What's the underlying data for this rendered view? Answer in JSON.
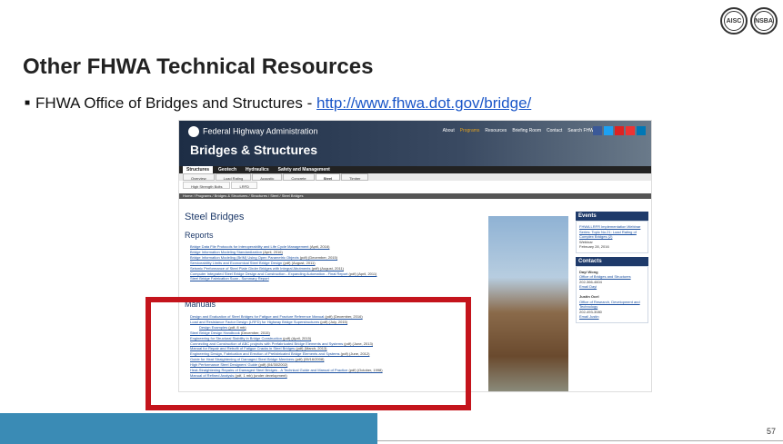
{
  "slide": {
    "title": "Other FHWA Technical Resources",
    "bullet_text": "FHWA Office of Bridges and Structures - ",
    "bullet_link": "http://www.fhwa.dot.gov/bridge/",
    "page_number": "57",
    "logos": [
      "AISC",
      "NSBA"
    ]
  },
  "website": {
    "agency": "Federal Highway Administration",
    "site_name": "Bridges & Structures",
    "top_links": [
      "About",
      "Programs",
      "Resources",
      "Briefing Room",
      "Contact",
      "Search FHWA"
    ],
    "nav_primary": [
      "Structures",
      "Geotech",
      "Hydraulics",
      "Safety and Management"
    ],
    "nav_secondary": [
      "Overview",
      "Load Rating",
      "Acoustic",
      "Concrete",
      "Steel",
      "Timber"
    ],
    "nav_tertiary": [
      "High Strength Bolts",
      "LRFD"
    ],
    "breadcrumb": "Home / Programs / Bridges & Structures / Structures / Steel / Steel Bridges",
    "page_heading": "Steel Bridges",
    "reports_heading": "Reports",
    "reports": [
      {
        "text": "Bridge Data File Protocols for Interoperability and Life Cycle Management",
        "note": " (April, 2016)"
      },
      {
        "text": "Bridge Information Modeling Standardization",
        "note": " (April, 2016)"
      },
      {
        "text": "Bridge Information Modeling (BrIM) Using Open Parametric Objects",
        "note": " (pdf) (December, 2015)"
      },
      {
        "text": "Serviceability Limits and Economical Steel Bridge Design",
        "note": " (pdf) (August, 2011)"
      },
      {
        "text": "Seismic Performance of Steel Plate Girder Bridges with Integral Abutments",
        "note": " (pdf) (August, 2011)"
      },
      {
        "text": "Computer Integrated Steel Bridge Design and Construction - Expanding Automation - Final Report",
        "note": " (pdf) (April, 2011)"
      },
      {
        "text": "Steel Bridge Fabrication Scan - Summary Report",
        "note": ""
      }
    ],
    "manuals_heading": "Manuals",
    "manuals": [
      {
        "text": "Design and Evaluation of Steel Bridges for Fatigue and Fracture Reference Manual",
        "note": " (pdf) (December, 2016)",
        "sub": false
      },
      {
        "text": "Load and Resistance Factor Design (LRFD) for Highway Bridge Superstructures",
        "note": " (pdf) (July, 2015)",
        "sub": false
      },
      {
        "text": "Design Examples",
        "note": " (pdf, 8 mb)",
        "sub": true
      },
      {
        "text": "Steel Bridge Design Handbook",
        "note": " (December, 2015)",
        "sub": false
      },
      {
        "text": "Engineering for Structural Stability in Bridge Construction",
        "note": " (pdf) (April, 2015)",
        "sub": false
      },
      {
        "text": "Connecting and Construction of ABC projects with Prefabricated Bridge Elements and Systems",
        "note": " (pdf) (June, 2013)",
        "sub": false
      },
      {
        "text": "Manual for Repair and Retrofit of Fatigue Cracks in Steel Bridges",
        "note": " (pdf) (March, 2013)",
        "sub": false
      },
      {
        "text": "Engineering Design, Fabrication and Erection of Prefabricated Bridge Elements and Systems",
        "note": " (pdf) (June, 2012)",
        "sub": false
      },
      {
        "text": "Guide for Heat Straightening of Damaged Steel Bridge Members",
        "note": " (pdf) (09/16/2008)",
        "sub": false
      },
      {
        "text": "High Performance Steel Designers' Guide",
        "note": " (pdf) (04/30/2002)",
        "sub": false
      },
      {
        "text": "Heat-Straightening Repairs of Damaged Steel Bridges - A Technical Guide and Manual of Practice",
        "note": " (pdf) (October, 1998)",
        "sub": false
      },
      {
        "text": "Manual of Refined Analysis",
        "note": " (pdf, 1 mb) (under development)",
        "sub": false
      }
    ],
    "sidebar": {
      "events_heading": "Events",
      "event_title": "FHWA LRFR Implementation Webinar Series: Topic No.21: Load Rating of Complex Bridges (2)",
      "event_type": "Webinar",
      "event_date": "February 28, 2016",
      "contacts_heading": "Contacts",
      "contact1_name": "Dayi Wong",
      "contact1_office": "Office of Bridges and Structures",
      "contact1_phone": "202-366-4604",
      "contact1_email": "Email Dayi",
      "contact2_name": "Justin Ocel",
      "contact2_office": "Office of Research, Development and Technology",
      "contact2_phone": "202-493-3080",
      "contact2_email": "Email Justin"
    }
  },
  "colors": {
    "title": "#222222",
    "link": "#1a56c8",
    "header": "#1d2d45",
    "highlight_box": "#c4141c",
    "footer_bar": "#3a8bb5"
  }
}
